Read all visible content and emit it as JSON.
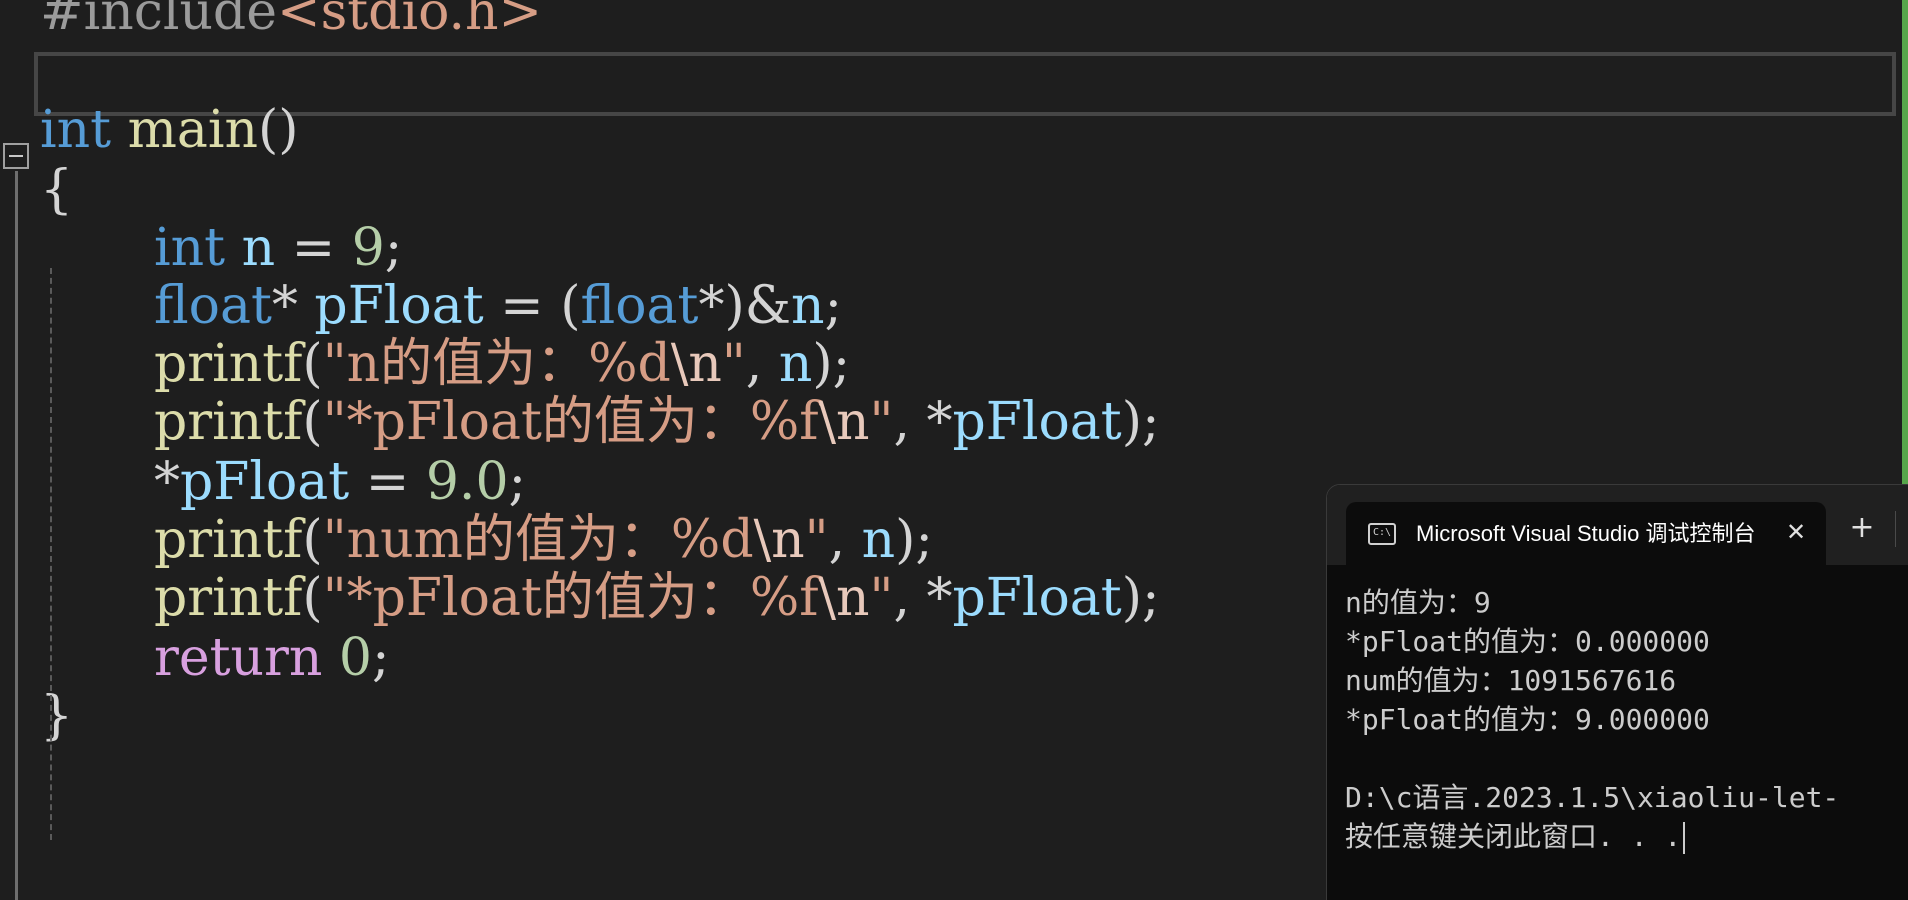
{
  "editor": {
    "include": {
      "directive": "#include",
      "header": "<stdio.h>"
    },
    "main_sig": {
      "type": "int",
      "name": "main",
      "parens": "()"
    },
    "open_brace": "{",
    "close_brace": "}",
    "line_int": {
      "type": "int",
      "var": "n",
      "op": " = ",
      "value": "9",
      "semi": ";"
    },
    "line_float": {
      "type": "float",
      "star": "* ",
      "var": "pFloat",
      "op": " = (",
      "cast_type": "float",
      "cast_rest": "*)&",
      "target": "n",
      "semi": ";"
    },
    "printf1": {
      "fn": "printf",
      "open": "(",
      "str_open": "\"n的值为：%d",
      "esc": "\\n",
      "str_close": "\"",
      "comma": ", ",
      "arg": "n",
      "close": ");"
    },
    "printf2": {
      "fn": "printf",
      "open": "(",
      "str_open": "\"*pFloat的值为：%f",
      "esc": "\\n",
      "str_close": "\"",
      "comma": ", *",
      "arg": "pFloat",
      "close": ");"
    },
    "assign": {
      "star": "*",
      "var": "pFloat",
      "op": " = ",
      "value": "9.0",
      "semi": ";"
    },
    "printf3": {
      "fn": "printf",
      "open": "(",
      "str_open": "\"num的值为：%d",
      "esc": "\\n",
      "str_close": "\"",
      "comma": ", ",
      "arg": "n",
      "close": ");"
    },
    "printf4": {
      "fn": "printf",
      "open": "(",
      "str_open": "\"*pFloat的值为：%f",
      "esc": "\\n",
      "str_close": "\"",
      "comma": ", *",
      "arg": "pFloat",
      "close": ");"
    },
    "ret": {
      "kw": "return",
      "value": "0",
      "semi": ";"
    }
  },
  "terminal": {
    "icon_label": "C:\\",
    "tab_title": "Microsoft Visual Studio 调试控制台",
    "close_glyph": "✕",
    "new_tab_glyph": "+",
    "lines": [
      "n的值为：9",
      "*pFloat的值为：0.000000",
      "num的值为：1091567616",
      "*pFloat的值为：9.000000",
      "",
      "D:\\c语言.2023.1.5\\xiaoliu-let-",
      "按任意键关闭此窗口. . ."
    ]
  },
  "colors": {
    "background": "#1e1e1e",
    "keyword": "#569cd6",
    "function": "#dcdcaa",
    "variable": "#9cdcfe",
    "string": "#d69d85",
    "number": "#b5cea8",
    "control_keyword": "#d8a0df",
    "terminal_bg": "#0c0c0c",
    "change_indicator": "#57a64a"
  }
}
